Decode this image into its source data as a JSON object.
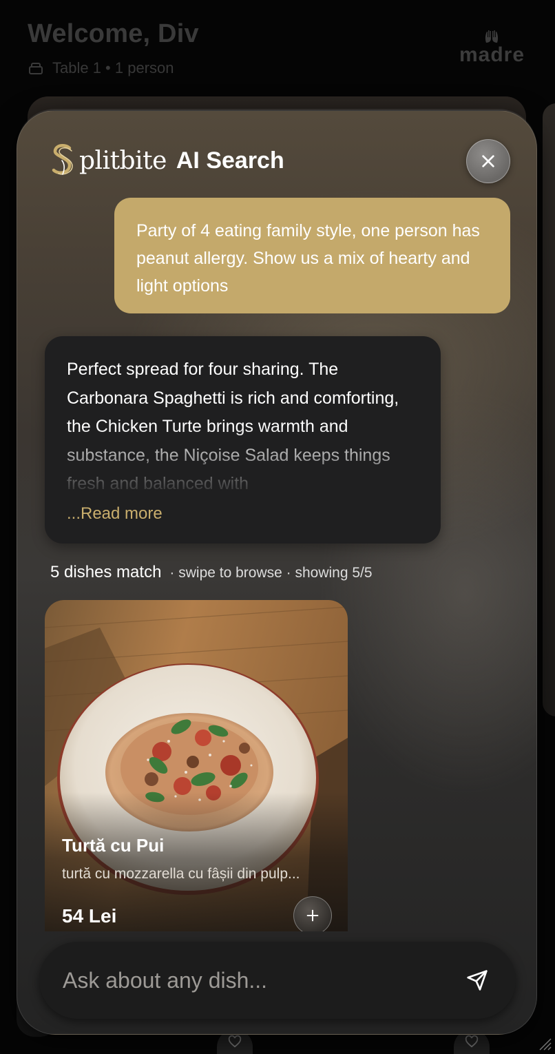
{
  "header": {
    "welcome": "Welcome, Div",
    "table_info": "Table 1 • 1 person",
    "brand": "madre"
  },
  "ai_search": {
    "logo_word": "plitbite",
    "title": "AI Search",
    "user_message": "Party of 4 eating family style, one person has peanut allergy. Show us a mix of hearty and light options",
    "ai_response": "Perfect spread for four sharing. The Carbonara Spaghetti is rich and comforting, the Chicken Turte brings warmth and substance, the Niçoise Salad keeps things fresh and balanced with",
    "read_more": "...Read more",
    "match_count": "5 dishes match",
    "match_meta": "· swipe to browse · showing 5/5"
  },
  "dish": {
    "name": "Turtă cu Pui",
    "description": "turtă cu mozzarella cu fâșii din pulp...",
    "price": "54 Lei"
  },
  "input": {
    "placeholder": "Ask about any dish..."
  },
  "colors": {
    "user_bubble": "#c4a96b",
    "ai_bubble": "#1f1f20",
    "accent_gold": "#c9ae6d",
    "background": "#050505"
  },
  "icons": [
    "lock-icon",
    "hands-logo-icon",
    "splitbite-logo-icon",
    "close-icon",
    "plus-icon",
    "send-icon",
    "heart-icon",
    "resize-grip-icon"
  ]
}
